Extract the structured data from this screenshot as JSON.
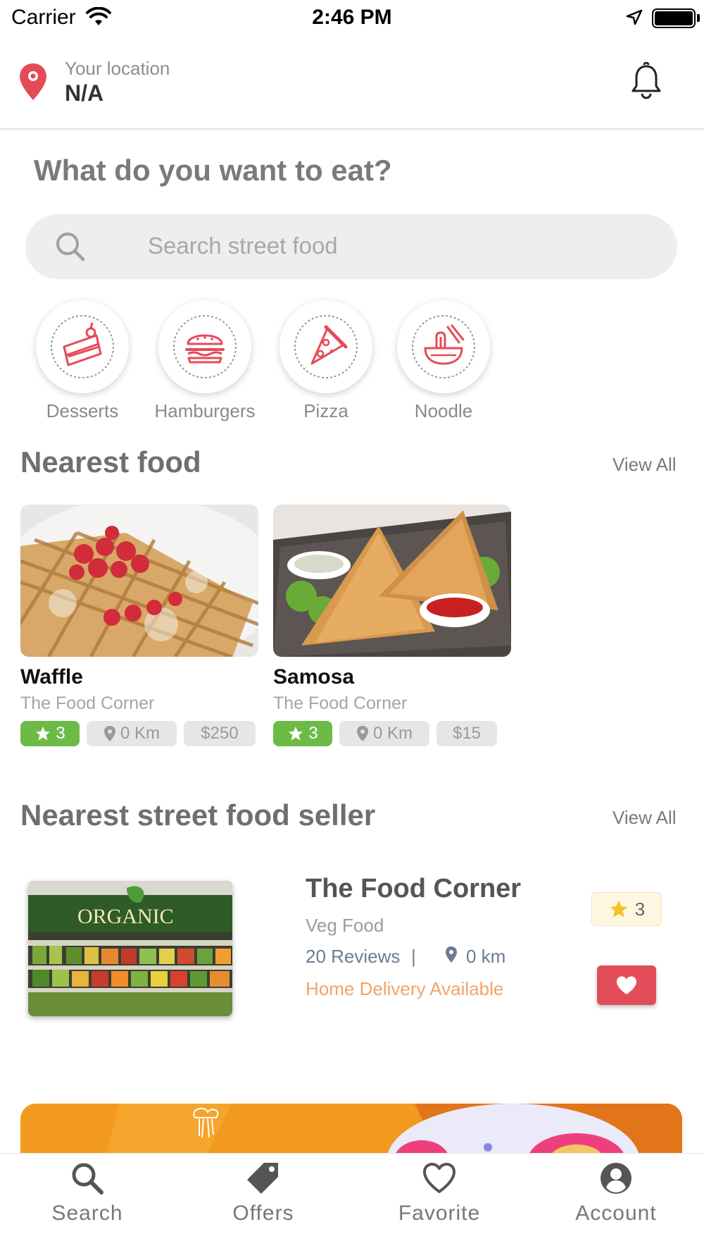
{
  "status_bar": {
    "carrier": "Carrier",
    "time": "2:46 PM"
  },
  "header": {
    "location_label": "Your location",
    "location_value": "N/A"
  },
  "question": "What do you want to eat?",
  "search": {
    "placeholder": "Search street food"
  },
  "categories": [
    {
      "label": "Desserts",
      "icon": "cake-icon"
    },
    {
      "label": "Hamburgers",
      "icon": "burger-icon"
    },
    {
      "label": "Pizza",
      "icon": "pizza-icon"
    },
    {
      "label": "Noodle",
      "icon": "noodle-icon"
    }
  ],
  "nearest_food": {
    "title": "Nearest food",
    "view_all": "View All",
    "items": [
      {
        "name": "Waffle",
        "seller": "The Food Corner",
        "rating": "3",
        "distance": "0 Km",
        "price": "$250"
      },
      {
        "name": "Samosa",
        "seller": "The Food Corner",
        "rating": "3",
        "distance": "0 Km",
        "price": "$15"
      }
    ]
  },
  "nearest_seller": {
    "title": "Nearest street food seller",
    "view_all": "View All",
    "seller": {
      "name": "The Food Corner",
      "type": "Veg Food",
      "reviews": "20 Reviews",
      "separator": "|",
      "distance": "0 km",
      "delivery": "Home Delivery Available",
      "rating": "3",
      "image_sign": "ORGANIC"
    }
  },
  "tabs": [
    {
      "label": "Search",
      "icon": "search-icon"
    },
    {
      "label": "Offers",
      "icon": "tag-icon"
    },
    {
      "label": "Favorite",
      "icon": "heart-icon"
    },
    {
      "label": "Account",
      "icon": "account-icon"
    }
  ],
  "colors": {
    "accent_red": "#e34d5a",
    "rating_green": "#6dbb47",
    "delivery_orange": "#f4a368",
    "banner_orange": "#f29a1f"
  }
}
